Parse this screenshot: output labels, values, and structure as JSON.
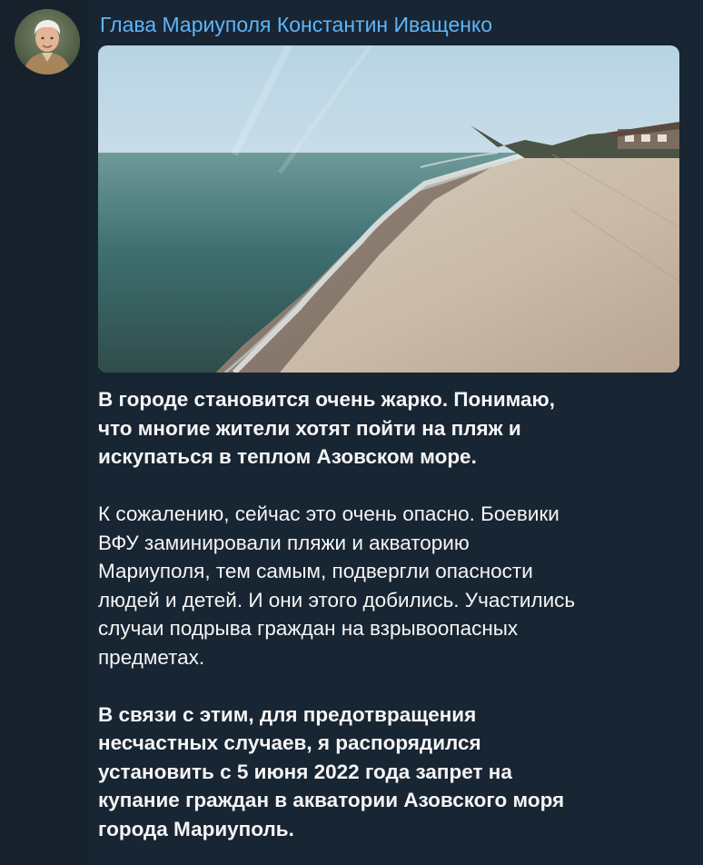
{
  "channel": {
    "sender_name": "Глава Мариуполя Константин Иващенко",
    "avatar_icon": "person-portrait-icon"
  },
  "post": {
    "photo_icon": "beach-photo-icon",
    "paragraph_1_lines": [
      "В городе становится очень жарко. Понимаю,",
      "что многие жители хотят пойти на пляж и",
      "искупаться в теплом Азовском море."
    ],
    "paragraph_2_lines": [
      "К сожалению, сейчас это очень опасно. Боевики",
      "ВФУ заминировали пляжи и акваторию",
      "Мариуполя, тем самым, подвергли опасности",
      "людей и детей. И они этого добились. Участились",
      "случаи подрыва граждан на взрывоопасных",
      "предметах."
    ],
    "paragraph_3_lines": [
      "В связи с этим, для предотвращения",
      "несчастных случаев, я распорядился",
      "установить с 5 июня 2022 года запрет на",
      "купание граждан в акватории Азовского моря",
      "города Мариуполь."
    ]
  },
  "colors": {
    "background": "#17212b",
    "bubble": "#182533",
    "sender_name": "#5eb5f7",
    "text": "#f5f5f5"
  }
}
